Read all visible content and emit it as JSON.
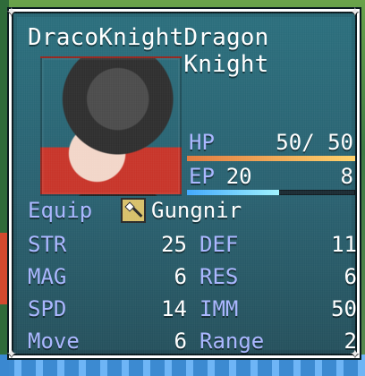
{
  "header": {
    "name": "DracoKnight",
    "class": "Dragon Knight"
  },
  "portrait": {
    "icon": "helmeted-knight-portrait"
  },
  "status": {
    "hp": {
      "label": "HP",
      "current": "50",
      "max": "50",
      "fraction": 1.0
    },
    "ep": {
      "label": "EP",
      "current": "20",
      "max": "8",
      "fraction": 0.55
    }
  },
  "equip": {
    "label": "Equip",
    "item_name": "Gungnir",
    "icon": "spear-icon"
  },
  "stats": {
    "str_label": "STR",
    "str_value": "25",
    "def_label": "DEF",
    "def_value": "11",
    "mag_label": "MAG",
    "mag_value": "6",
    "res_label": "RES",
    "res_value": "6",
    "spd_label": "SPD",
    "spd_value": "14",
    "imm_label": "IMM",
    "imm_value": "50",
    "move_label": "Move",
    "move_value": "6",
    "range_label": "Range",
    "range_value": "2"
  },
  "colors": {
    "label_blue": "#a9b6ff",
    "value_white": "#ffffff",
    "hp_fill_start": "#e17a3e",
    "hp_fill_end": "#ffd36b",
    "ep_fill_start": "#40a8ff",
    "ep_fill_end": "#9ff3ff"
  }
}
